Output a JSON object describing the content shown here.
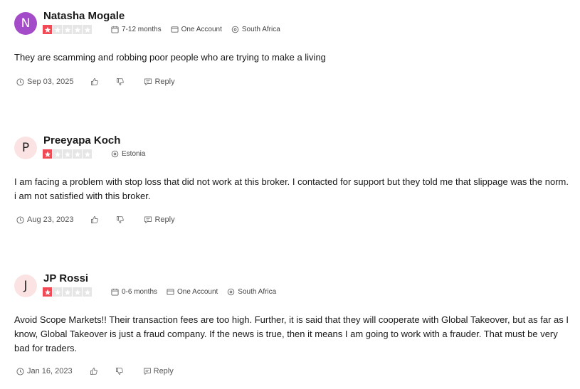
{
  "reviews": [
    {
      "avatar_letter": "N",
      "avatar_color": "#a44bc9",
      "name": "Natasha Mogale",
      "rating": 1,
      "max_rating": 5,
      "meta": {
        "duration": "7-12 months",
        "account": "One Account",
        "location": "South Africa"
      },
      "text": "They are scamming and robbing poor people who are trying to make a living",
      "date": "Sep 03, 2025",
      "reply_label": "Reply"
    },
    {
      "avatar_letter": "P",
      "avatar_color": "#fbe3e3",
      "name": "Preeyapa Koch",
      "rating": 1,
      "max_rating": 5,
      "meta": {
        "location": "Estonia"
      },
      "text": "I am facing a problem with stop loss that did not work at this broker. I contacted for support but they told me that slippage was the norm. i am not satisfied with this broker.",
      "date": "Aug 23, 2023",
      "reply_label": "Reply"
    },
    {
      "avatar_letter": "J",
      "avatar_color": "#fbe3e3",
      "name": "JP Rossi",
      "rating": 1,
      "max_rating": 5,
      "meta": {
        "duration": "0-6 months",
        "account": "One Account",
        "location": "South Africa"
      },
      "text": "Avoid Scope Markets!! Their transaction fees are too high. Further, it is said that they will cooperate with Global Takeover, but as far as I know, Global Takeover is just a fraud company. If the news is true, then it means I am going to work with a frauder. That must be very bad for traders.",
      "date": "Jan 16, 2023",
      "reply_label": "Reply"
    }
  ],
  "colors": {
    "star_active": "#ef4a55",
    "star_inactive": "#e6e6e6"
  }
}
